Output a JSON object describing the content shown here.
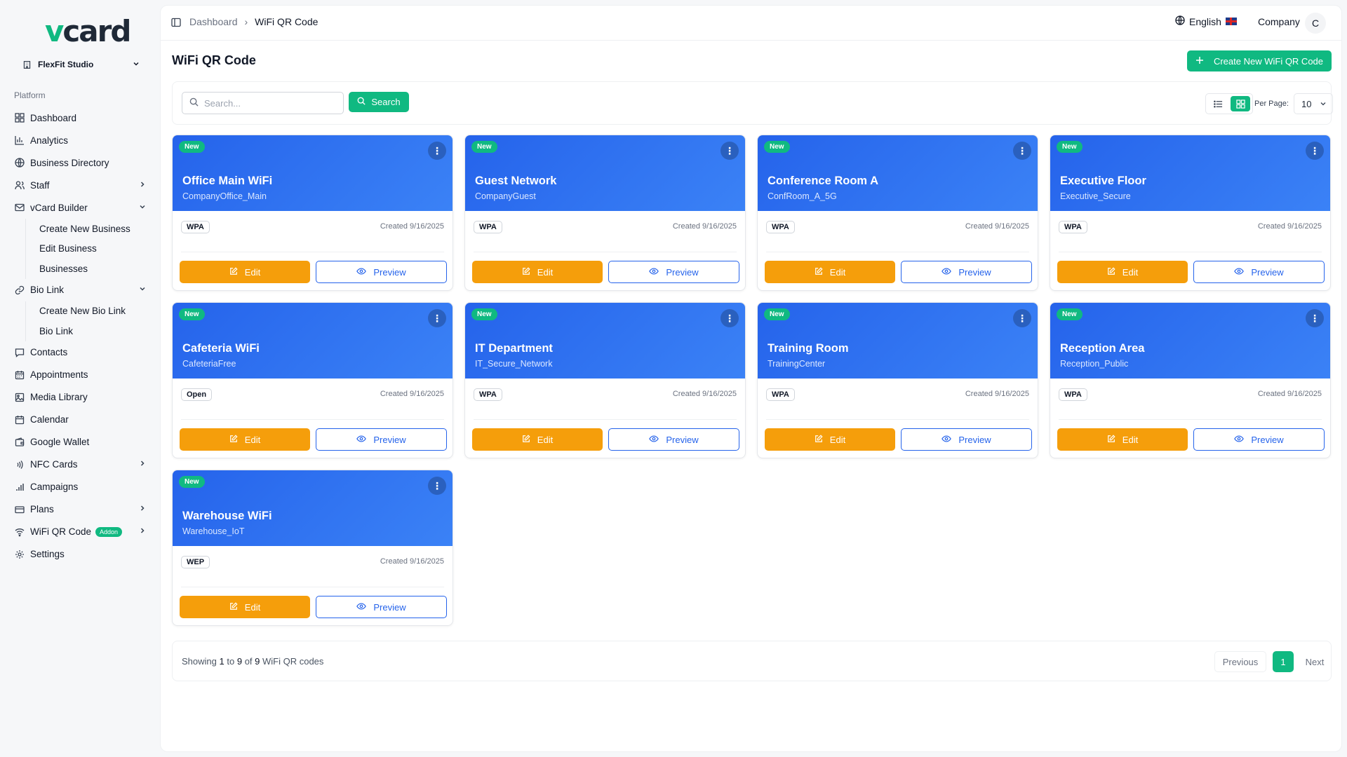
{
  "sidebar": {
    "logo_v": "v",
    "logo_rest": "card",
    "business": "FlexFit Studio",
    "group_label": "Platform",
    "items": [
      {
        "label": "Dashboard",
        "icon": "grid-icon"
      },
      {
        "label": "Analytics",
        "icon": "bar-chart-icon"
      },
      {
        "label": "Business Directory",
        "icon": "globe-icon"
      },
      {
        "label": "Staff",
        "icon": "users-icon"
      },
      {
        "label": "vCard Builder",
        "icon": "mail-icon"
      },
      {
        "label": "Create New Business"
      },
      {
        "label": "Edit Business"
      },
      {
        "label": "Businesses"
      },
      {
        "label": "Bio Link",
        "icon": "link-icon"
      },
      {
        "label": "Create New Bio Link"
      },
      {
        "label": "Bio Link"
      },
      {
        "label": "Contacts",
        "icon": "message-icon"
      },
      {
        "label": "Appointments",
        "icon": "calendar-icon"
      },
      {
        "label": "Media Library",
        "icon": "image-icon"
      },
      {
        "label": "Calendar",
        "icon": "calendar-icon"
      },
      {
        "label": "Google Wallet",
        "icon": "wallet-icon"
      },
      {
        "label": "NFC Cards",
        "icon": "nfc-icon"
      },
      {
        "label": "Campaigns",
        "icon": "signal-icon"
      },
      {
        "label": "Plans",
        "icon": "card-icon"
      },
      {
        "label": "WiFi QR Code",
        "icon": "wifi-icon",
        "badge": "Addon"
      },
      {
        "label": "Settings",
        "icon": "gear-icon"
      }
    ]
  },
  "header": {
    "breadcrumb_root": "Dashboard",
    "breadcrumb_sep": "›",
    "breadcrumb_current": "WiFi QR Code",
    "language": "English",
    "company": "Company",
    "avatar_initial": "C"
  },
  "page": {
    "title": "WiFi QR Code",
    "create_label": "Create New WiFi QR Code",
    "search_placeholder": "Search...",
    "search_label": "Search",
    "per_page_label": "Per Page:",
    "per_page_value": "10"
  },
  "card_labels": {
    "new_badge": "New",
    "edit": "Edit",
    "preview": "Preview"
  },
  "cards": [
    {
      "name": "Office Main WiFi",
      "ssid": "CompanyOffice_Main",
      "security": "WPA",
      "created": "Created 9/16/2025"
    },
    {
      "name": "Guest Network",
      "ssid": "CompanyGuest",
      "security": "WPA",
      "created": "Created 9/16/2025"
    },
    {
      "name": "Conference Room A",
      "ssid": "ConfRoom_A_5G",
      "security": "WPA",
      "created": "Created 9/16/2025"
    },
    {
      "name": "Executive Floor",
      "ssid": "Executive_Secure",
      "security": "WPA",
      "created": "Created 9/16/2025"
    },
    {
      "name": "Cafeteria WiFi",
      "ssid": "CafeteriaFree",
      "security": "Open",
      "created": "Created 9/16/2025"
    },
    {
      "name": "IT Department",
      "ssid": "IT_Secure_Network",
      "security": "WPA",
      "created": "Created 9/16/2025"
    },
    {
      "name": "Training Room",
      "ssid": "TrainingCenter",
      "security": "WPA",
      "created": "Created 9/16/2025"
    },
    {
      "name": "Reception Area",
      "ssid": "Reception_Public",
      "security": "WPA",
      "created": "Created 9/16/2025"
    },
    {
      "name": "Warehouse WiFi",
      "ssid": "Warehouse_IoT",
      "security": "WEP",
      "created": "Created 9/16/2025"
    }
  ],
  "pagination": {
    "showing_prefix": "Showing",
    "from": "1",
    "to_word": "to",
    "to": "9",
    "of_word": "of",
    "total": "9",
    "suffix": "WiFi QR codes",
    "previous": "Previous",
    "current_page": "1",
    "next": "Next"
  },
  "colors": {
    "accent": "#10b981",
    "card_header": "#2563eb",
    "edit_button": "#f59e0b"
  }
}
